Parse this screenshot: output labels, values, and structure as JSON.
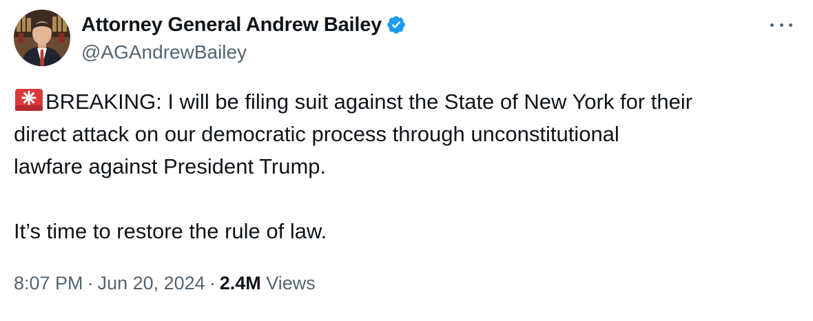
{
  "author": {
    "display_name": "Attorney General Andrew Bailey",
    "handle": "@AGAndrewBailey",
    "verified": true,
    "verified_color": "#1d9bf0"
  },
  "tweet": {
    "emoji_icon": "police-light-icon",
    "lines": [
      "BREAKING: I will be filing suit against the State of New York for their",
      "direct attack on our democratic process through unconstitutional",
      "lawfare against President Trump.",
      "It’s time to restore the rule of law."
    ]
  },
  "meta": {
    "time": "8:07 PM",
    "separator": "·",
    "date": "Jun 20, 2024",
    "views_count": "2.4M",
    "views_label": "Views"
  },
  "colors": {
    "text_primary": "#0f1419",
    "text_secondary": "#536471",
    "accent": "#1d9bf0"
  }
}
